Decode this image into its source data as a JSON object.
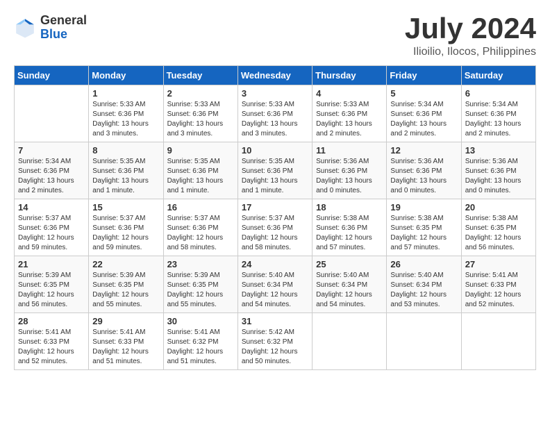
{
  "header": {
    "logo_general": "General",
    "logo_blue": "Blue",
    "title": "July 2024",
    "subtitle": "Ilioilio, Ilocos, Philippines"
  },
  "days_of_week": [
    "Sunday",
    "Monday",
    "Tuesday",
    "Wednesday",
    "Thursday",
    "Friday",
    "Saturday"
  ],
  "weeks": [
    [
      {
        "day": "",
        "info": ""
      },
      {
        "day": "1",
        "info": "Sunrise: 5:33 AM\nSunset: 6:36 PM\nDaylight: 13 hours\nand 3 minutes."
      },
      {
        "day": "2",
        "info": "Sunrise: 5:33 AM\nSunset: 6:36 PM\nDaylight: 13 hours\nand 3 minutes."
      },
      {
        "day": "3",
        "info": "Sunrise: 5:33 AM\nSunset: 6:36 PM\nDaylight: 13 hours\nand 3 minutes."
      },
      {
        "day": "4",
        "info": "Sunrise: 5:33 AM\nSunset: 6:36 PM\nDaylight: 13 hours\nand 2 minutes."
      },
      {
        "day": "5",
        "info": "Sunrise: 5:34 AM\nSunset: 6:36 PM\nDaylight: 13 hours\nand 2 minutes."
      },
      {
        "day": "6",
        "info": "Sunrise: 5:34 AM\nSunset: 6:36 PM\nDaylight: 13 hours\nand 2 minutes."
      }
    ],
    [
      {
        "day": "7",
        "info": "Sunrise: 5:34 AM\nSunset: 6:36 PM\nDaylight: 13 hours\nand 2 minutes."
      },
      {
        "day": "8",
        "info": "Sunrise: 5:35 AM\nSunset: 6:36 PM\nDaylight: 13 hours\nand 1 minute."
      },
      {
        "day": "9",
        "info": "Sunrise: 5:35 AM\nSunset: 6:36 PM\nDaylight: 13 hours\nand 1 minute."
      },
      {
        "day": "10",
        "info": "Sunrise: 5:35 AM\nSunset: 6:36 PM\nDaylight: 13 hours\nand 1 minute."
      },
      {
        "day": "11",
        "info": "Sunrise: 5:36 AM\nSunset: 6:36 PM\nDaylight: 13 hours\nand 0 minutes."
      },
      {
        "day": "12",
        "info": "Sunrise: 5:36 AM\nSunset: 6:36 PM\nDaylight: 13 hours\nand 0 minutes."
      },
      {
        "day": "13",
        "info": "Sunrise: 5:36 AM\nSunset: 6:36 PM\nDaylight: 13 hours\nand 0 minutes."
      }
    ],
    [
      {
        "day": "14",
        "info": "Sunrise: 5:37 AM\nSunset: 6:36 PM\nDaylight: 12 hours\nand 59 minutes."
      },
      {
        "day": "15",
        "info": "Sunrise: 5:37 AM\nSunset: 6:36 PM\nDaylight: 12 hours\nand 59 minutes."
      },
      {
        "day": "16",
        "info": "Sunrise: 5:37 AM\nSunset: 6:36 PM\nDaylight: 12 hours\nand 58 minutes."
      },
      {
        "day": "17",
        "info": "Sunrise: 5:37 AM\nSunset: 6:36 PM\nDaylight: 12 hours\nand 58 minutes."
      },
      {
        "day": "18",
        "info": "Sunrise: 5:38 AM\nSunset: 6:36 PM\nDaylight: 12 hours\nand 57 minutes."
      },
      {
        "day": "19",
        "info": "Sunrise: 5:38 AM\nSunset: 6:35 PM\nDaylight: 12 hours\nand 57 minutes."
      },
      {
        "day": "20",
        "info": "Sunrise: 5:38 AM\nSunset: 6:35 PM\nDaylight: 12 hours\nand 56 minutes."
      }
    ],
    [
      {
        "day": "21",
        "info": "Sunrise: 5:39 AM\nSunset: 6:35 PM\nDaylight: 12 hours\nand 56 minutes."
      },
      {
        "day": "22",
        "info": "Sunrise: 5:39 AM\nSunset: 6:35 PM\nDaylight: 12 hours\nand 55 minutes."
      },
      {
        "day": "23",
        "info": "Sunrise: 5:39 AM\nSunset: 6:35 PM\nDaylight: 12 hours\nand 55 minutes."
      },
      {
        "day": "24",
        "info": "Sunrise: 5:40 AM\nSunset: 6:34 PM\nDaylight: 12 hours\nand 54 minutes."
      },
      {
        "day": "25",
        "info": "Sunrise: 5:40 AM\nSunset: 6:34 PM\nDaylight: 12 hours\nand 54 minutes."
      },
      {
        "day": "26",
        "info": "Sunrise: 5:40 AM\nSunset: 6:34 PM\nDaylight: 12 hours\nand 53 minutes."
      },
      {
        "day": "27",
        "info": "Sunrise: 5:41 AM\nSunset: 6:33 PM\nDaylight: 12 hours\nand 52 minutes."
      }
    ],
    [
      {
        "day": "28",
        "info": "Sunrise: 5:41 AM\nSunset: 6:33 PM\nDaylight: 12 hours\nand 52 minutes."
      },
      {
        "day": "29",
        "info": "Sunrise: 5:41 AM\nSunset: 6:33 PM\nDaylight: 12 hours\nand 51 minutes."
      },
      {
        "day": "30",
        "info": "Sunrise: 5:41 AM\nSunset: 6:32 PM\nDaylight: 12 hours\nand 51 minutes."
      },
      {
        "day": "31",
        "info": "Sunrise: 5:42 AM\nSunset: 6:32 PM\nDaylight: 12 hours\nand 50 minutes."
      },
      {
        "day": "",
        "info": ""
      },
      {
        "day": "",
        "info": ""
      },
      {
        "day": "",
        "info": ""
      }
    ]
  ]
}
